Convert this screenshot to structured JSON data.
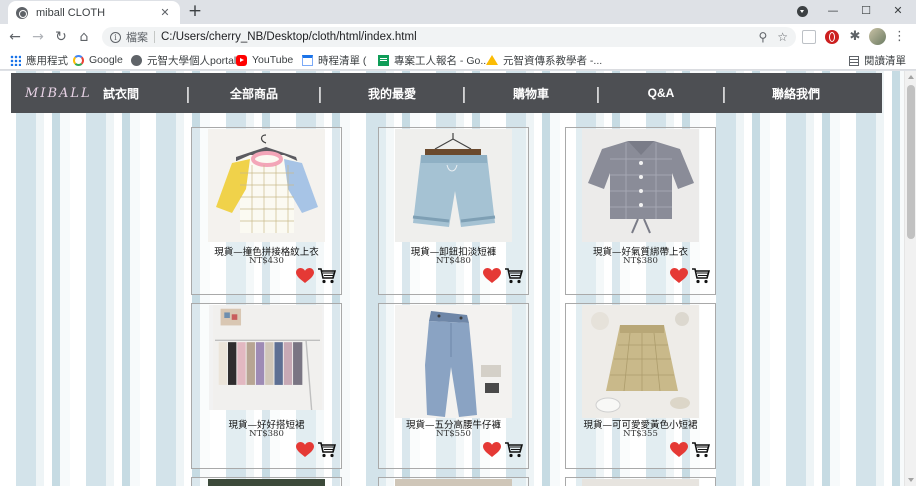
{
  "browser": {
    "tab_title": "miball CLOTH",
    "tab_close": "✕",
    "new_tab": "+",
    "address_scheme": "檔案",
    "address_url": "C:/Users/cherry_NB/Desktop/cloth/html/index.html",
    "window_controls": [
      "—",
      "☐",
      "✕"
    ],
    "bookmarks": [
      {
        "label": "應用程式",
        "icon": "apps-icon"
      },
      {
        "label": "Google",
        "icon": "google-icon"
      },
      {
        "label": "元智大學個人portal",
        "icon": "globe-icon"
      },
      {
        "label": "YouTube",
        "icon": "youtube-icon"
      },
      {
        "label": "時程清單 (",
        "icon": "calendar-icon"
      },
      {
        "label": "專案工人報名 - Go...",
        "icon": "sheets-icon"
      },
      {
        "label": "元智資傳系教學者 -...",
        "icon": "drive-icon"
      }
    ],
    "reading_list": "閱讀清單"
  },
  "site": {
    "logo": "MIBALL",
    "nav": [
      "試衣間",
      "全部商品",
      "我的最愛",
      "購物車",
      "Q&A",
      "聯絡我們"
    ],
    "separator": "|"
  },
  "products": [
    {
      "name": "現貨—撞色拼接格紋上衣",
      "price": "NT$430",
      "photo": "color-block-tee"
    },
    {
      "name": "現貨—卸鈕扣淡短褲",
      "price": "NT$480",
      "photo": "denim-shorts"
    },
    {
      "name": "現貨—好氣質綁帶上衣",
      "price": "NT$380",
      "photo": "gingham-top"
    },
    {
      "name": "現貨—好好搭短裙",
      "price": "NT$380",
      "photo": "skirt-rack"
    },
    {
      "name": "現貨—五分高腰牛仔褲",
      "price": "NT$550",
      "photo": "denim-jeans"
    },
    {
      "name": "現貨—可可愛愛黃色小短裙",
      "price": "NT$355",
      "photo": "yellow-plaid-skirt"
    }
  ],
  "colors": {
    "nav_bg": "#4d4f53",
    "heart": "#e53935",
    "cart": "#111111"
  }
}
